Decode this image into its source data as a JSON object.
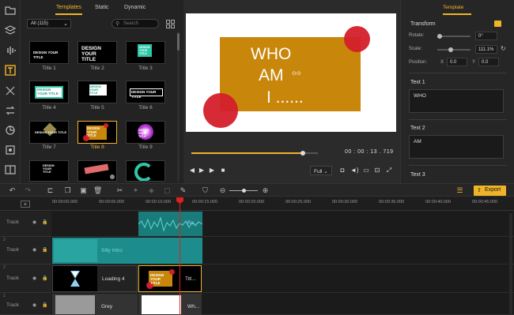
{
  "library": {
    "tabs": [
      "Templates",
      "Static",
      "Dynamic"
    ],
    "active_tab": "Templates",
    "filter_value": "All (115)",
    "search_placeholder": "Search",
    "items": [
      {
        "label": "Title 1",
        "text": "DESIGN YOUR TITLE"
      },
      {
        "label": "Title 2",
        "text": "DESIGN YOUR TITLE"
      },
      {
        "label": "Title 3",
        "text": "DESIGN YOUR TITLE"
      },
      {
        "label": "Title 4",
        "text": "DESIGN YOUR TITLE"
      },
      {
        "label": "Title 5",
        "text": "DESIGN YOUR TITLE"
      },
      {
        "label": "Title 6",
        "text": "DESIGN YOUR TITLE"
      },
      {
        "label": "Title 7",
        "text": "DESIGN YOUR TITLE"
      },
      {
        "label": "Title 8",
        "text": "DESIGN YOUR TITLE"
      },
      {
        "label": "Title 9",
        "text": "DESIGN YOUR TITLE"
      },
      {
        "label": "",
        "text": "DESIGN YOUR TITLE"
      },
      {
        "label": "",
        "text": ""
      },
      {
        "label": "",
        "text": ""
      }
    ],
    "selected_item": "Title 8"
  },
  "preview": {
    "canvas_lines": [
      "WHO",
      "AM",
      "I ......"
    ],
    "timecode": "00 : 00 : 13 . 719",
    "progress_fraction": 0.88,
    "quality": "Full"
  },
  "properties": {
    "tab": "Template",
    "section_transform": "Transform",
    "rotate_label": "Rotate:",
    "rotate_value": "0°",
    "scale_label": "Scale:",
    "scale_value": "111.1%",
    "position_label": "Position:",
    "x_label": "X",
    "x_value": "0.0",
    "y_label": "Y",
    "y_value": "0.0",
    "text1_label": "Text 1",
    "text1_value": "WHO",
    "text2_label": "Text 2",
    "text2_value": "AM",
    "text3_label": "Text 3"
  },
  "toolbar": {
    "export_label": "Export"
  },
  "ruler": {
    "ticks": [
      "00:00:00.000",
      "00:00:05.000",
      "00:00:10.000",
      "00:00:15.000",
      "00:00:20.000",
      "00:00:25.000",
      "00:00:30.000",
      "00:00:35.000",
      "00:00:40.000",
      "00:00:45.000"
    ]
  },
  "tracks": [
    {
      "num": "",
      "name": "Track"
    },
    {
      "num": "3",
      "name": "Track"
    },
    {
      "num": "2",
      "name": "Track"
    },
    {
      "num": "1",
      "name": "Track"
    }
  ],
  "clips": {
    "audio_label": "Ro...",
    "video_label": "Silly Intro",
    "loading_label": "Loading 4",
    "title_clip_label": "Titl...",
    "grey_label": "Grey",
    "white_label": "Wh..."
  },
  "colors": {
    "accent": "#f0b429",
    "canvas_box": "#c8860a",
    "circle_red": "#d41f2b",
    "teal_clip": "#1d8c8c"
  }
}
